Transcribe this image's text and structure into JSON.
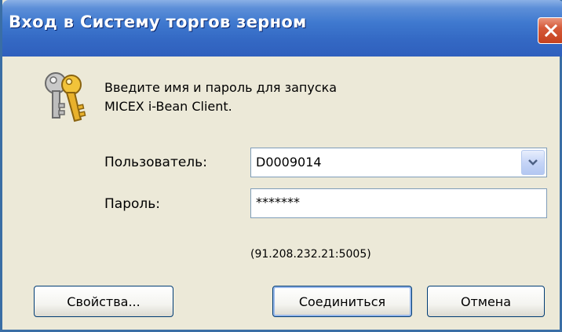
{
  "window": {
    "title": "Вход в Систему торгов зерном"
  },
  "message": {
    "line1": "Введите имя и пароль для запуска",
    "line2": "MICEX i-Bean Client."
  },
  "form": {
    "user_label": "Пользователь:",
    "user_value": "D0009014",
    "password_label": "Пароль:",
    "password_value": "*******",
    "server": "(91.208.232.21:5005)"
  },
  "buttons": {
    "properties": "Свойства...",
    "connect": "Соединиться",
    "cancel": "Отмена"
  },
  "icons": {
    "dialog": "keys-icon",
    "close": "close-icon",
    "dropdown": "chevron-down-icon"
  },
  "colors": {
    "titlebar": "#3469c4",
    "close_button": "#c5411e",
    "dialog_bg": "#ece9d8"
  }
}
